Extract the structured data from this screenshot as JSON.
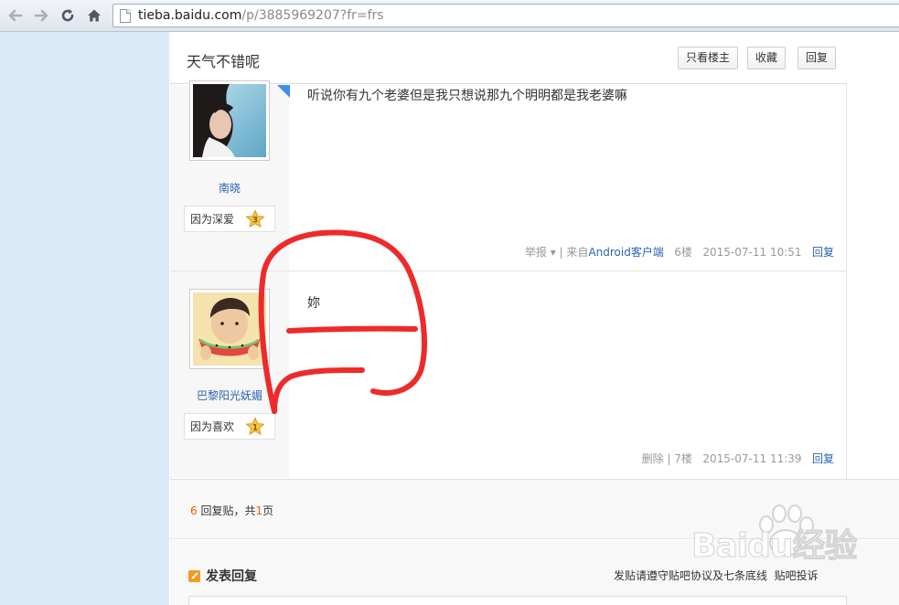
{
  "browser": {
    "url_host": "tieba.baidu.com",
    "url_path": "/p/3885969207?fr=frs",
    "back_icon": "back-arrow-icon",
    "forward_icon": "forward-arrow-icon",
    "reload_icon": "reload-icon",
    "home_icon": "home-icon"
  },
  "thread": {
    "title": "天气不错呢",
    "buttons": {
      "only_op": "只看楼主",
      "favorite": "收藏",
      "reply": "回复"
    }
  },
  "posts": [
    {
      "username": "南晓",
      "badge_label": "因为深爱",
      "badge_level": "3",
      "content": "听说你有九个老婆但是我只想说那九个明明都是我老婆嘛",
      "report": "举报",
      "source_prefix": "| 来自",
      "source_link": "Android客户端",
      "floor": "6楼",
      "time": "2015-07-11 10:51",
      "reply": "回复"
    },
    {
      "username": "巴黎阳光妩媚",
      "badge_label": "因为喜欢",
      "badge_level": "1",
      "content": "妳",
      "delete": "删除",
      "floor": "| 7楼",
      "time": "2015-07-11 11:39",
      "reply": "回复"
    }
  ],
  "pager": {
    "count": "6",
    "count_suffix": " 回复贴，共",
    "pages": "1",
    "pages_suffix": "页"
  },
  "reply_section": {
    "title": "发表回复",
    "rules": "发贴请遵守贴吧协议及七条底线",
    "rules_link": "贴吧投诉"
  },
  "watermark": {
    "text": "Baidu经验"
  },
  "colors": {
    "accent_link": "#2d64b3",
    "highlight_orange": "#f45c00",
    "annotation_red": "#ee2a2a",
    "page_background": "#dbeaf9"
  }
}
